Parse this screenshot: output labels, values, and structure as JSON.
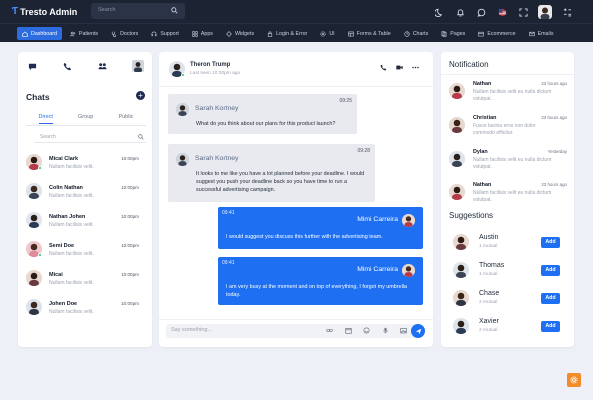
{
  "app": {
    "title": "Tresto Admin"
  },
  "topbar": {
    "search_placeholder": "Search"
  },
  "nav": {
    "items": [
      {
        "label": "Dashboard",
        "icon": "home-icon"
      },
      {
        "label": "Patients",
        "icon": "users-icon"
      },
      {
        "label": "Doctors",
        "icon": "stethoscope-icon"
      },
      {
        "label": "Support",
        "icon": "headset-icon"
      },
      {
        "label": "Apps",
        "icon": "grid-icon"
      },
      {
        "label": "Widgets",
        "icon": "widget-icon"
      },
      {
        "label": "Login & Error",
        "icon": "lock-icon"
      },
      {
        "label": "UI",
        "icon": "settings-icon"
      },
      {
        "label": "Forms & Table",
        "icon": "table-icon"
      },
      {
        "label": "Charts",
        "icon": "chart-icon"
      },
      {
        "label": "Pages",
        "icon": "page-icon"
      },
      {
        "label": "Ecommerce",
        "icon": "cart-icon"
      },
      {
        "label": "Emails",
        "icon": "mail-icon"
      }
    ]
  },
  "chats": {
    "title": "Chats",
    "tabs": [
      "Direct",
      "Group",
      "Public"
    ],
    "search_placeholder": "Search",
    "list": [
      {
        "name": "Micai Clark",
        "message": "Nullam facilisis velit.",
        "time": "10:00pm",
        "online": true
      },
      {
        "name": "Colin Nathan",
        "message": "Nullam facilisis velit.",
        "time": "10:00pm",
        "online": false
      },
      {
        "name": "Nathan Johen",
        "message": "Nullam facilisis velit.",
        "time": "10:00pm",
        "online": false
      },
      {
        "name": "Semi Doe",
        "message": "Nullam facilisis velit.",
        "time": "10:00pm",
        "online": true
      },
      {
        "name": "Micai",
        "message": "Nullam facilisis velit.",
        "time": "10:00pm",
        "online": false
      },
      {
        "name": "Johen Doe",
        "message": "Nullam facilisis velit.",
        "time": "10:00pm",
        "online": false
      }
    ]
  },
  "conversation": {
    "contact": "Theron Trump",
    "last_seen": "Last seen 10:30pm ago",
    "composer_placeholder": "Say something...",
    "messages": [
      {
        "direction": "in",
        "sender": "Sarah Kortney",
        "time": "09:25",
        "text": "What do you think about our plans for this product launch?"
      },
      {
        "direction": "in",
        "sender": "Sarah Kortney",
        "time": "09:28",
        "text": "It looks to me like you have a lot planned before your deadline. I would suggest you push your deadline back so you have time to run a successful advertising campaign."
      },
      {
        "direction": "out",
        "sender": "Mimi Carreira",
        "time": "09:41",
        "text": "I would suggest you discuss this further with the advertising team."
      },
      {
        "direction": "out",
        "sender": "Mimi Carreira",
        "time": "09:41",
        "text": "I am very busy at the moment and on top of everything, I forgot my umbrella today."
      }
    ]
  },
  "notifications": {
    "title": "Notification",
    "items": [
      {
        "name": "Nathan",
        "time": "23 hours ago",
        "text": "Nullam facilisis velit eu nulla dictum volutpat."
      },
      {
        "name": "Christian",
        "time": "23 hours ago",
        "text": "Fusce lacinia eros non dolor commodo efficitur."
      },
      {
        "name": "Dylan",
        "time": "Yesterday",
        "text": "Nullam facilisis velit eu nulla dictum volutpat."
      },
      {
        "name": "Nathan",
        "time": "23 hours ago",
        "text": "Nullam facilisis velit eu nulla dictum volutpat."
      }
    ]
  },
  "suggestions": {
    "title": "Suggestions",
    "add_label": "Add",
    "items": [
      {
        "name": "Austin",
        "mutual": "1 mutual"
      },
      {
        "name": "Thomas",
        "mutual": "1 mutual"
      },
      {
        "name": "Chase",
        "mutual": "2 mutual"
      },
      {
        "name": "Xavier",
        "mutual": "2 mutual"
      }
    ]
  },
  "colors": {
    "primary": "#1e6ff2",
    "topbar": "#1c2333",
    "accent_fab": "#f28c28",
    "online": "#22c55e"
  }
}
